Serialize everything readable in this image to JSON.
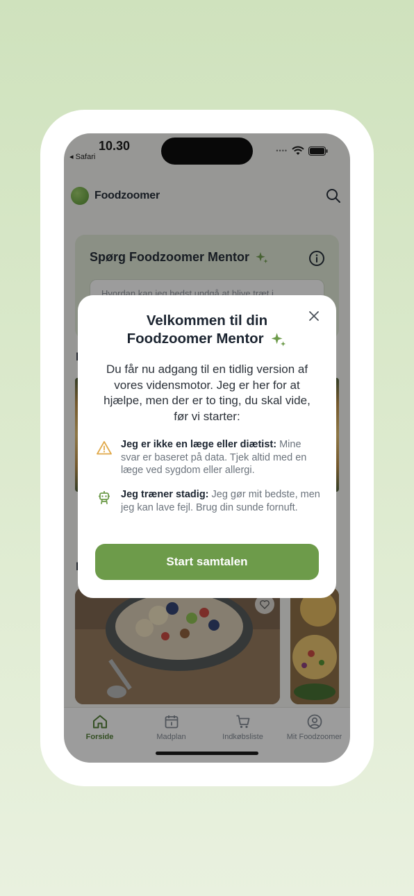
{
  "status": {
    "time": "10.30",
    "back_label": "◂ Safari"
  },
  "app": {
    "name": "Foodzoomer"
  },
  "mentor_card": {
    "title": "Spørg Foodzoomer Mentor",
    "input_placeholder": "Hvordan kan jeg bedst undgå at blive træt i"
  },
  "background_sections": [
    {
      "letter": "N"
    },
    {
      "letter": "I"
    }
  ],
  "modal": {
    "title_line1": "Velkommen til din",
    "title_line2": "Foodzoomer Mentor",
    "intro": "Du får nu adgang til en tidlig version af vores vidensmotor. Jeg er her for at hjælpe, men der er to ting, du skal vide, før vi starter:",
    "notes": [
      {
        "icon": "warning-icon",
        "bold": "Jeg er ikke en læge eller diætist:",
        "text": " Mine svar er baseret på data. Tjek altid med en læge ved sygdom eller allergi."
      },
      {
        "icon": "robot-icon",
        "bold": "Jeg træner stadig:",
        "text": " Jeg gør mit bedste, men jeg kan lave fejl. Brug din sunde fornuft."
      }
    ],
    "button_label": "Start samtalen"
  },
  "tabs": [
    {
      "label": "Forside",
      "icon": "home-icon",
      "active": true
    },
    {
      "label": "Madplan",
      "icon": "calendar-icon",
      "active": false
    },
    {
      "label": "Indkøbsliste",
      "icon": "cart-icon",
      "active": false
    },
    {
      "label": "Mit Foodzoomer",
      "icon": "user-circle-icon",
      "active": false
    }
  ],
  "colors": {
    "accent": "#6d9b4a",
    "warning": "#e0a94a",
    "active_tab": "#4c7a2f"
  }
}
